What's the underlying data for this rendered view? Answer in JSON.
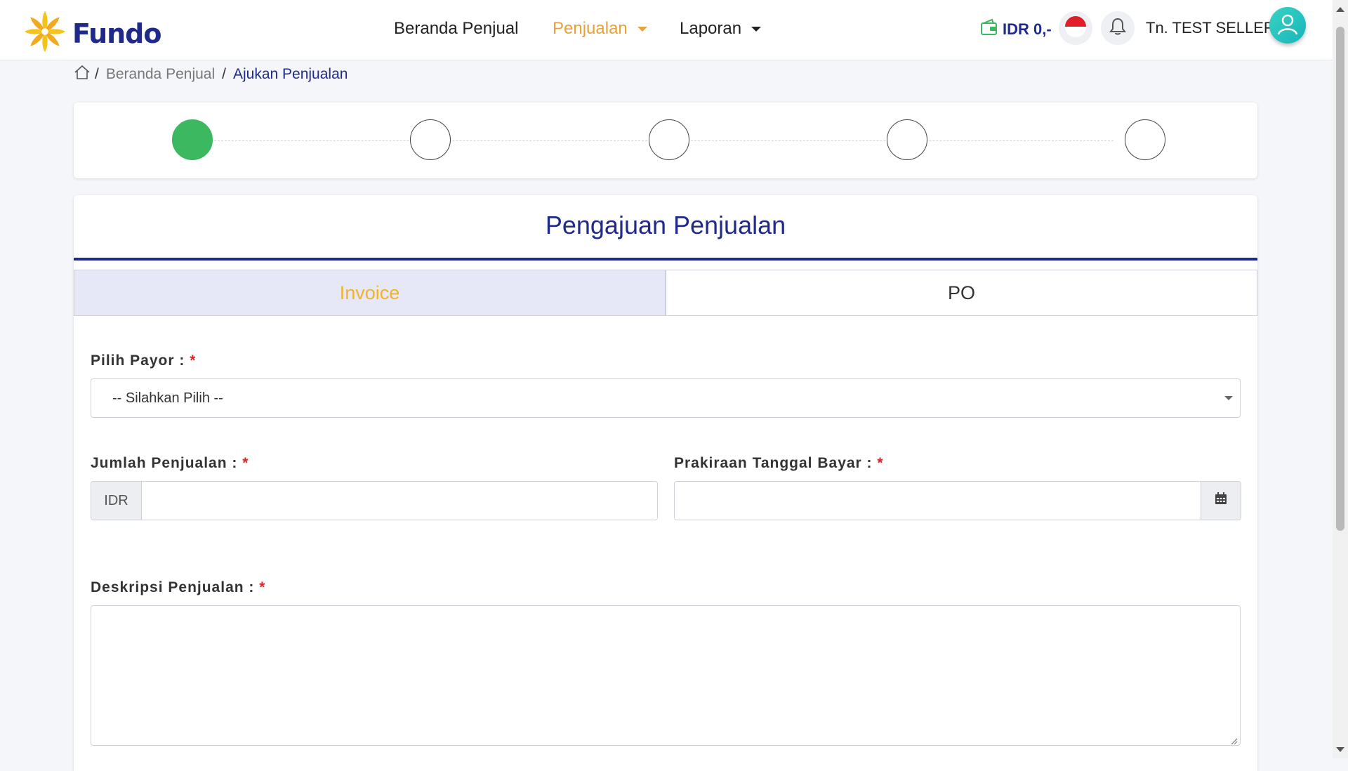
{
  "app": {
    "name": "Fundo",
    "brand_color": "#1f2a8a",
    "accent_color": "#e8a13a",
    "logo_icon": "fundo-flower-logo-icon"
  },
  "nav": {
    "items": [
      {
        "label": "Beranda Penjual",
        "active": false,
        "has_dropdown": false
      },
      {
        "label": "Penjualan",
        "active": true,
        "has_dropdown": true
      },
      {
        "label": "Laporan",
        "active": false,
        "has_dropdown": true
      }
    ],
    "wallet": {
      "icon": "wallet-icon",
      "balance": "IDR 0,-"
    },
    "language_icon": "indonesia-flag-icon",
    "notification_icon": "bell-icon",
    "user": {
      "name": "Tn. TEST SELLER",
      "avatar_icon": "user-avatar-icon"
    }
  },
  "breadcrumb": {
    "home_icon": "home-icon",
    "separator": "/",
    "items": [
      "Beranda Penjual",
      "Ajukan Penjualan"
    ]
  },
  "stepper": {
    "total_steps": 5,
    "completed_steps": 1,
    "done_color": "#3bb860"
  },
  "form": {
    "title": "Pengajuan Penjualan",
    "tabs": [
      {
        "label": "Invoice",
        "active": true
      },
      {
        "label": "PO",
        "active": false
      }
    ],
    "payor": {
      "label": "Pilih Payor :",
      "required_mark": "*",
      "selected": "-- Silahkan Pilih --"
    },
    "amount": {
      "label": "Jumlah Penjualan :",
      "required_mark": "*",
      "prefix": "IDR",
      "value": ""
    },
    "pay_date": {
      "label": "Prakiraan Tanggal Bayar :",
      "required_mark": "*",
      "value": "",
      "icon": "calendar-icon"
    },
    "description": {
      "label": "Deskripsi Penjualan :",
      "required_mark": "*",
      "value": ""
    }
  }
}
